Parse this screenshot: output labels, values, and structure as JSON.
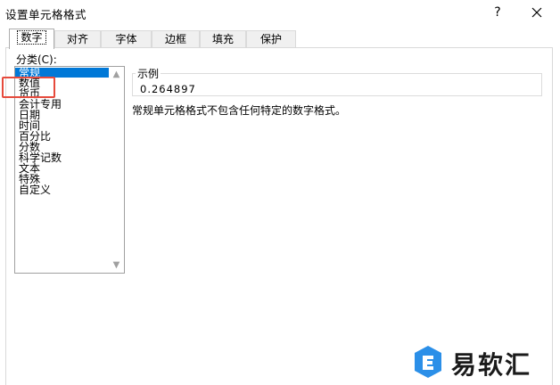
{
  "dialog": {
    "title": "设置单元格格式",
    "help_label": "?"
  },
  "tabs": [
    {
      "label": "数字",
      "active": true
    },
    {
      "label": "对齐"
    },
    {
      "label": "字体"
    },
    {
      "label": "边框"
    },
    {
      "label": "填充"
    },
    {
      "label": "保护"
    }
  ],
  "category": {
    "label": "分类(C):",
    "items": [
      "常规",
      "数值",
      "货币",
      "会计专用",
      "日期",
      "时间",
      "百分比",
      "分数",
      "科学记数",
      "文本",
      "特殊",
      "自定义"
    ],
    "selected": "常规",
    "highlighted": "数值"
  },
  "sample": {
    "legend": "示例",
    "value": "0.264897"
  },
  "description": "常规单元格格式不包含任何特定的数字格式。",
  "watermark": {
    "text": "易软汇"
  },
  "colors": {
    "selection": "#0078d7",
    "highlight": "#e64a3c",
    "watermark_blue": "#2b8fe8"
  }
}
